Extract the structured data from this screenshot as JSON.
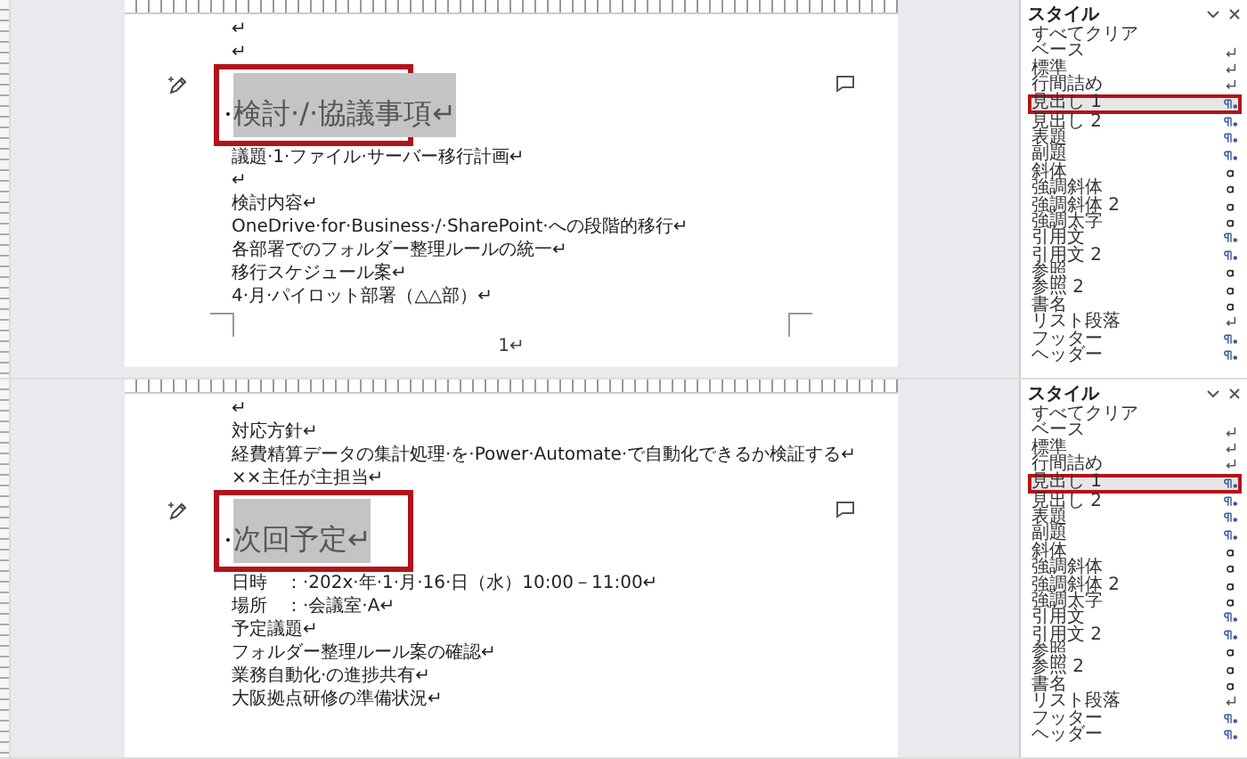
{
  "views": [
    {
      "paragraphs": [
        {
          "kind": "body",
          "text": "↵"
        },
        {
          "kind": "body",
          "text": "↵"
        },
        {
          "kind": "heading",
          "text": "検討·/·協議事項↵",
          "selected": true,
          "annotated": true
        },
        {
          "kind": "body",
          "text": "議題·1·ファイル·サーバー移行計画↵"
        },
        {
          "kind": "body",
          "text": "↵"
        },
        {
          "kind": "body",
          "text": "検討内容↵"
        },
        {
          "kind": "body",
          "text": "OneDrive·for·Business·/·SharePoint·への段階的移行↵"
        },
        {
          "kind": "body",
          "text": "各部署でのフォルダー整理ルールの統一↵"
        },
        {
          "kind": "body",
          "text": "移行スケジュール案↵"
        },
        {
          "kind": "body",
          "text": "4·月·パイロット部署（△△部）↵"
        },
        {
          "kind": "page_end",
          "text": "1↵"
        }
      ],
      "styles": {
        "title": "スタイル",
        "items": [
          {
            "label": "すべてクリア",
            "kind": "none",
            "selected": false,
            "annotated": false
          },
          {
            "label": "ベース",
            "kind": "paragraph",
            "selected": false,
            "annotated": false
          },
          {
            "label": "標準",
            "kind": "paragraph",
            "selected": false,
            "annotated": false
          },
          {
            "label": "行間詰め",
            "kind": "paragraph",
            "selected": false,
            "annotated": false
          },
          {
            "label": "見出し 1",
            "kind": "linked",
            "selected": true,
            "annotated": true
          },
          {
            "label": "見出し 2",
            "kind": "linked",
            "selected": false,
            "annotated": false
          },
          {
            "label": "表題",
            "kind": "linked",
            "selected": false,
            "annotated": false
          },
          {
            "label": "副題",
            "kind": "linked",
            "selected": false,
            "annotated": false
          },
          {
            "label": "斜体",
            "kind": "character",
            "selected": false,
            "annotated": false
          },
          {
            "label": "強調斜体",
            "kind": "character",
            "selected": false,
            "annotated": false
          },
          {
            "label": "強調斜体 2",
            "kind": "character",
            "selected": false,
            "annotated": false
          },
          {
            "label": "強調太字",
            "kind": "character",
            "selected": false,
            "annotated": false
          },
          {
            "label": "引用文",
            "kind": "linked",
            "selected": false,
            "annotated": false
          },
          {
            "label": "引用文 2",
            "kind": "linked",
            "selected": false,
            "annotated": false
          },
          {
            "label": "参照",
            "kind": "character",
            "selected": false,
            "annotated": false
          },
          {
            "label": "参照 2",
            "kind": "character",
            "selected": false,
            "annotated": false
          },
          {
            "label": "書名",
            "kind": "character",
            "selected": false,
            "annotated": false
          },
          {
            "label": "リスト段落",
            "kind": "paragraph",
            "selected": false,
            "annotated": false
          },
          {
            "label": "フッター",
            "kind": "linked",
            "selected": false,
            "annotated": false
          },
          {
            "label": "ヘッダー",
            "kind": "linked",
            "selected": false,
            "annotated": false
          }
        ]
      }
    },
    {
      "paragraphs": [
        {
          "kind": "body",
          "text": "↵"
        },
        {
          "kind": "body",
          "text": "対応方針↵"
        },
        {
          "kind": "body",
          "text": "経費精算データの集計処理·を·Power·Automate·で自動化できるか検証する↵"
        },
        {
          "kind": "body",
          "text": "××主任が主担当↵"
        },
        {
          "kind": "heading",
          "text": "次回予定↵",
          "selected": true,
          "annotated": true
        },
        {
          "kind": "body",
          "text": "日時　：·202x·年·1·月·16·日（水）10:00－11:00↵"
        },
        {
          "kind": "body",
          "text": "場所　：·会議室·A↵"
        },
        {
          "kind": "body",
          "text": "予定議題↵"
        },
        {
          "kind": "body",
          "text": "フォルダー整理ルール案の確認↵"
        },
        {
          "kind": "body",
          "text": "業務自動化·の進捗共有↵"
        },
        {
          "kind": "body",
          "text": "大阪拠点研修の準備状況↵"
        }
      ],
      "styles": {
        "title": "スタイル",
        "items": [
          {
            "label": "すべてクリア",
            "kind": "none",
            "selected": false,
            "annotated": false
          },
          {
            "label": "ベース",
            "kind": "paragraph",
            "selected": false,
            "annotated": false
          },
          {
            "label": "標準",
            "kind": "paragraph",
            "selected": false,
            "annotated": false
          },
          {
            "label": "行間詰め",
            "kind": "paragraph",
            "selected": false,
            "annotated": false
          },
          {
            "label": "見出し 1",
            "kind": "linked",
            "selected": true,
            "annotated": true
          },
          {
            "label": "見出し 2",
            "kind": "linked",
            "selected": false,
            "annotated": false
          },
          {
            "label": "表題",
            "kind": "linked",
            "selected": false,
            "annotated": false
          },
          {
            "label": "副題",
            "kind": "linked",
            "selected": false,
            "annotated": false
          },
          {
            "label": "斜体",
            "kind": "character",
            "selected": false,
            "annotated": false
          },
          {
            "label": "強調斜体",
            "kind": "character",
            "selected": false,
            "annotated": false
          },
          {
            "label": "強調斜体 2",
            "kind": "character",
            "selected": false,
            "annotated": false
          },
          {
            "label": "強調太字",
            "kind": "character",
            "selected": false,
            "annotated": false
          },
          {
            "label": "引用文",
            "kind": "linked",
            "selected": false,
            "annotated": false
          },
          {
            "label": "引用文 2",
            "kind": "linked",
            "selected": false,
            "annotated": false
          },
          {
            "label": "参照",
            "kind": "character",
            "selected": false,
            "annotated": false
          },
          {
            "label": "参照 2",
            "kind": "character",
            "selected": false,
            "annotated": false
          },
          {
            "label": "書名",
            "kind": "character",
            "selected": false,
            "annotated": false
          },
          {
            "label": "リスト段落",
            "kind": "paragraph",
            "selected": false,
            "annotated": false
          },
          {
            "label": "フッター",
            "kind": "linked",
            "selected": false,
            "annotated": false
          },
          {
            "label": "ヘッダー",
            "kind": "linked",
            "selected": false,
            "annotated": false
          }
        ]
      }
    }
  ]
}
